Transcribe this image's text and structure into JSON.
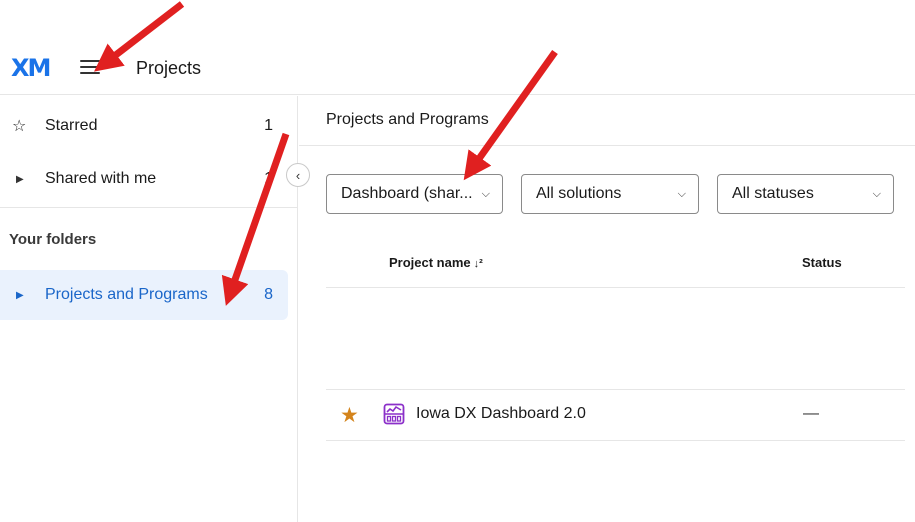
{
  "header": {
    "logo": "XM",
    "menu_icon": "hamburger-icon",
    "title": "Projects"
  },
  "sidebar": {
    "items": [
      {
        "label": "Starred",
        "count": "1",
        "icon": "star-outline-icon"
      },
      {
        "label": "Shared with me",
        "count": "1",
        "icon": "caret-right-icon"
      }
    ],
    "section_label": "Your folders",
    "folders": [
      {
        "label": "Projects and Programs",
        "count": "8",
        "icon": "caret-right-icon",
        "selected": true
      }
    ],
    "collapse_icon": "chevron-left-icon"
  },
  "main": {
    "title": "Projects and Programs",
    "filters": [
      {
        "value": "Dashboard (shar...",
        "icon": "chevron-down-icon"
      },
      {
        "value": "All solutions",
        "icon": "chevron-down-icon"
      },
      {
        "value": "All statuses",
        "icon": "chevron-down-icon"
      }
    ],
    "table": {
      "columns": [
        "Project name",
        "Status"
      ],
      "sort_icon": "sort-descending-icon",
      "rows": [
        {
          "starred": true,
          "icon": "dashboard-icon",
          "name": "Iowa DX Dashboard 2.0",
          "status": "—"
        }
      ]
    }
  },
  "colors": {
    "accent": "#1a66c9",
    "selected_bg": "#eaf2fd",
    "star": "#d4841c",
    "dashboard_icon": "#8b2fc9",
    "annotation_arrow": "#e02020"
  }
}
